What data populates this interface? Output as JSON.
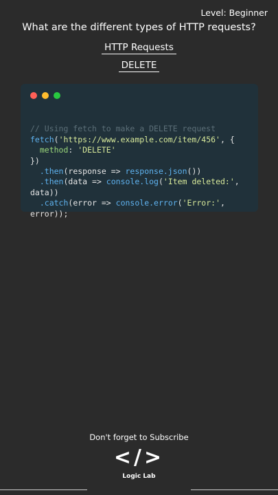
{
  "header": {
    "level": "Level: Beginner",
    "question": "What are the different types of HTTP requests?",
    "topic": "HTTP Requests",
    "method": "DELETE"
  },
  "code_window": {
    "dots": [
      "red",
      "yellow",
      "green"
    ],
    "lines": [
      "// Using fetch to make a DELETE request",
      "fetch('https://www.example.com/item/456', {",
      "  method: 'DELETE'",
      "})",
      "  .then(response => response.json())",
      "  .then(data => console.log('Item deleted:',",
      "data))",
      "  .catch(error => console.error('Error:',",
      "error));"
    ]
  },
  "footer": {
    "subscribe": "Don't forget to Subscribe",
    "logo_symbol": "</>",
    "logo_name": "Logic Lab"
  },
  "colors": {
    "background": "#2b2b2b",
    "code_bg": "#20313a",
    "comment": "#5c6f78",
    "function": "#5fb3f0",
    "string": "#d7e99a"
  }
}
